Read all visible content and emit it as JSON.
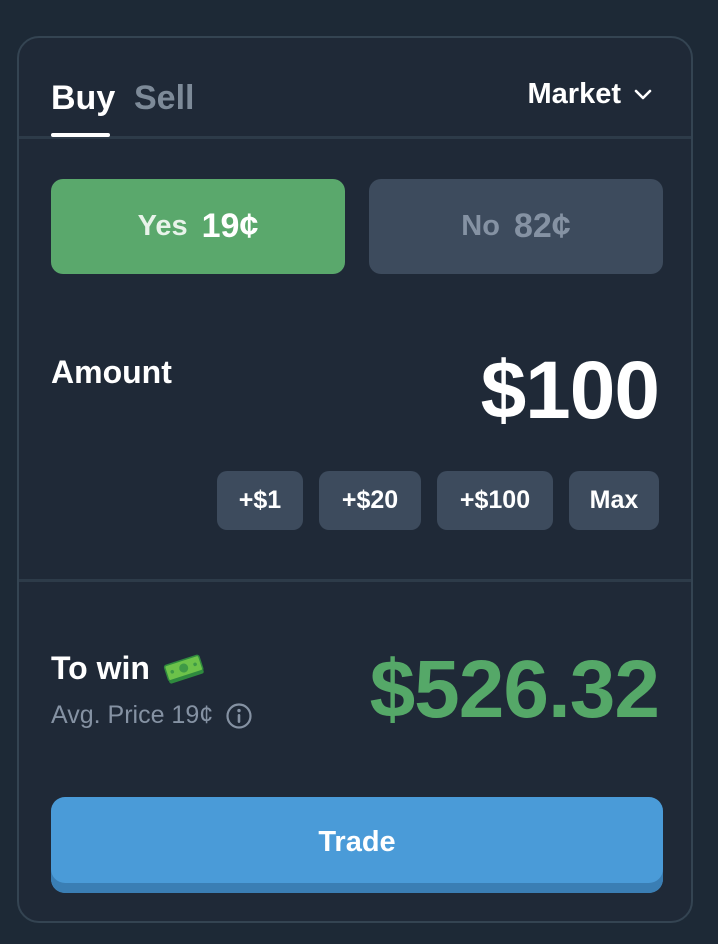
{
  "tabs": [
    {
      "label": "Buy",
      "active": true
    },
    {
      "label": "Sell",
      "active": false
    }
  ],
  "order_type": {
    "selected": "Market"
  },
  "outcomes": {
    "yes": {
      "label": "Yes",
      "price": "19¢",
      "selected": true,
      "color": "#5aa86c"
    },
    "no": {
      "label": "No",
      "price": "82¢",
      "selected": false,
      "color": "#3d4b5d"
    }
  },
  "amount": {
    "label": "Amount",
    "value": "$100",
    "quick_buttons": [
      "+$1",
      "+$20",
      "+$100",
      "Max"
    ]
  },
  "payout": {
    "label": "To win",
    "icon": "money-bill-icon",
    "avg_price": "Avg. Price 19¢",
    "value": "$526.32",
    "color": "#55a868"
  },
  "trade_button": {
    "label": "Trade",
    "color": "#4a9bd8"
  }
}
